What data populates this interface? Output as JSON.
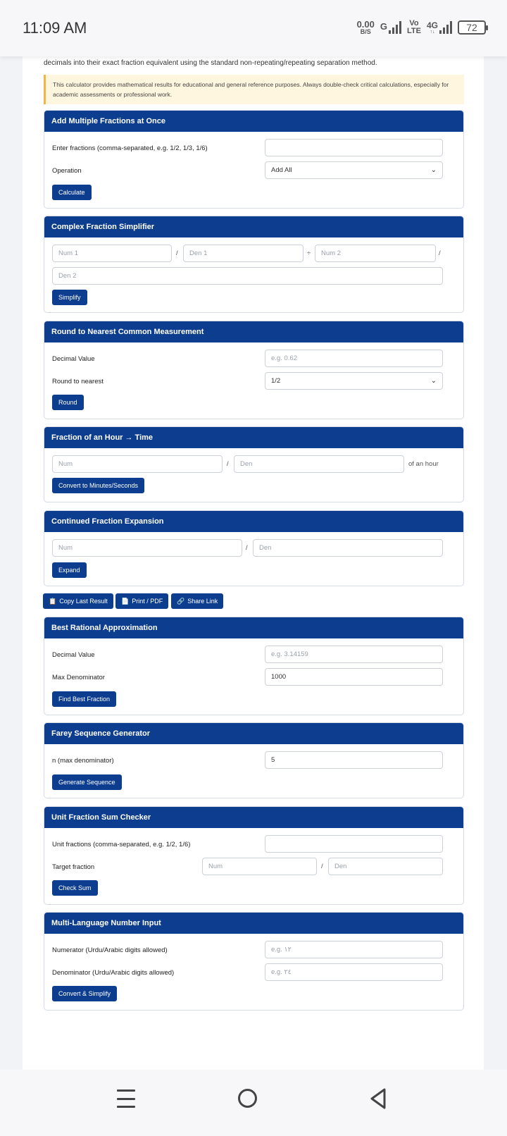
{
  "status": {
    "time": "11:09 AM",
    "speed_value": "0.00",
    "speed_unit": "B/S",
    "network_g": "G",
    "vo": "Vo",
    "lte": "LTE",
    "net_4g": "4G",
    "net_4g_arrows": "↑↓",
    "battery": "72"
  },
  "intro_text": "decimals into their exact fraction equivalent using the standard non-repeating/repeating separation method.",
  "notice_text": "This calculator provides mathematical results for educational and general reference purposes. Always double-check critical calculations, especially for academic assessments or professional work.",
  "add_multiple": {
    "title": "Add Multiple Fractions at Once",
    "fractions_label": "Enter fractions (comma-separated, e.g. 1/2, 1/3, 1/6)",
    "fractions_value": "",
    "operation_label": "Operation",
    "operation_value": "Add All",
    "button": "Calculate"
  },
  "complex": {
    "title": "Complex Fraction Simplifier",
    "num1_placeholder": "Num 1",
    "den1_placeholder": "Den 1",
    "num2_placeholder": "Num 2",
    "den2_placeholder": "Den 2",
    "slash": "/",
    "divide": "÷",
    "button": "Simplify"
  },
  "round": {
    "title": "Round to Nearest Common Measurement",
    "decimal_label": "Decimal Value",
    "decimal_placeholder": "e.g. 0.62",
    "nearest_label": "Round to nearest",
    "nearest_value": "1/2",
    "button": "Round"
  },
  "hour": {
    "title": "Fraction of an Hour → Time",
    "num_placeholder": "Num",
    "den_placeholder": "Den",
    "slash": "/",
    "suffix": "of an hour",
    "button": "Convert to Minutes/Seconds"
  },
  "continued": {
    "title": "Continued Fraction Expansion",
    "num_placeholder": "Num",
    "den_placeholder": "Den",
    "slash": "/",
    "button": "Expand"
  },
  "toolbar": {
    "copy": "Copy Last Result",
    "print": "Print / PDF",
    "share": "Share Link"
  },
  "best": {
    "title": "Best Rational Approximation",
    "decimal_label": "Decimal Value",
    "decimal_placeholder": "e.g. 3.14159",
    "maxden_label": "Max Denominator",
    "maxden_value": "1000",
    "button": "Find Best Fraction"
  },
  "farey": {
    "title": "Farey Sequence Generator",
    "n_label": "n (max denominator)",
    "n_value": "5",
    "button": "Generate Sequence"
  },
  "unit": {
    "title": "Unit Fraction Sum Checker",
    "fractions_label": "Unit fractions (comma-separated, e.g. 1/2, 1/6)",
    "fractions_value": "",
    "target_label": "Target fraction",
    "num_placeholder": "Num",
    "den_placeholder": "Den",
    "slash": "/",
    "button": "Check Sum"
  },
  "multilang": {
    "title": "Multi-Language Number Input",
    "num_label": "Numerator (Urdu/Arabic digits allowed)",
    "num_placeholder": "e.g. ١٢",
    "den_label": "Denominator (Urdu/Arabic digits allowed)",
    "den_placeholder": "e.g. ٢٤",
    "button": "Convert & Simplify"
  }
}
